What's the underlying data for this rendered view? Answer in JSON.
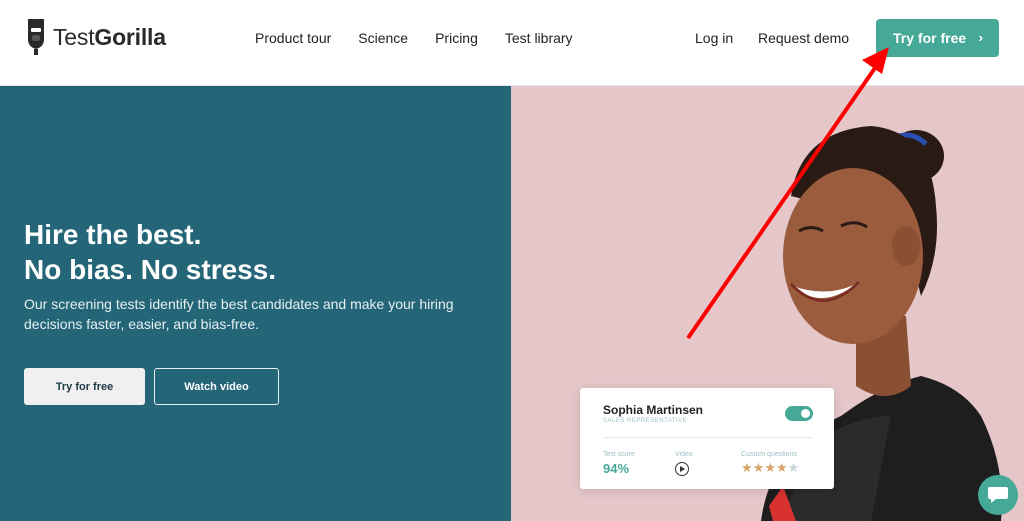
{
  "header": {
    "logo": {
      "text_light": "Test",
      "text_bold": "Gorilla",
      "icon": "gorilla-logo-icon"
    },
    "nav": [
      "Product tour",
      "Science",
      "Pricing",
      "Test library"
    ],
    "login_label": "Log in",
    "demo_label": "Request demo",
    "cta_label": "Try for free",
    "cta_icon": "chevron-right-icon"
  },
  "hero": {
    "title_line1": "Hire the best.",
    "title_line2": "No bias. No stress.",
    "subtitle": "Our screening tests identify the best candidates and make your hiring decisions faster, easier, and bias-free.",
    "primary_button": "Try for free",
    "secondary_button": "Watch video"
  },
  "card": {
    "name": "Sophia Martinsen",
    "role": "SALES REPRESENTATIVE",
    "toggle_on": true,
    "score_label": "Test score",
    "score_value": "94%",
    "video_label": "Video",
    "custom_label": "Custom questions",
    "rating": 4,
    "rating_max": 5
  },
  "colors": {
    "brand_green": "#46a997",
    "hero_teal": "#246678",
    "hero_pink": "#e5c6c9",
    "annotation_red": "#ff0000"
  },
  "chat": {
    "icon": "chat-bubble-icon"
  }
}
